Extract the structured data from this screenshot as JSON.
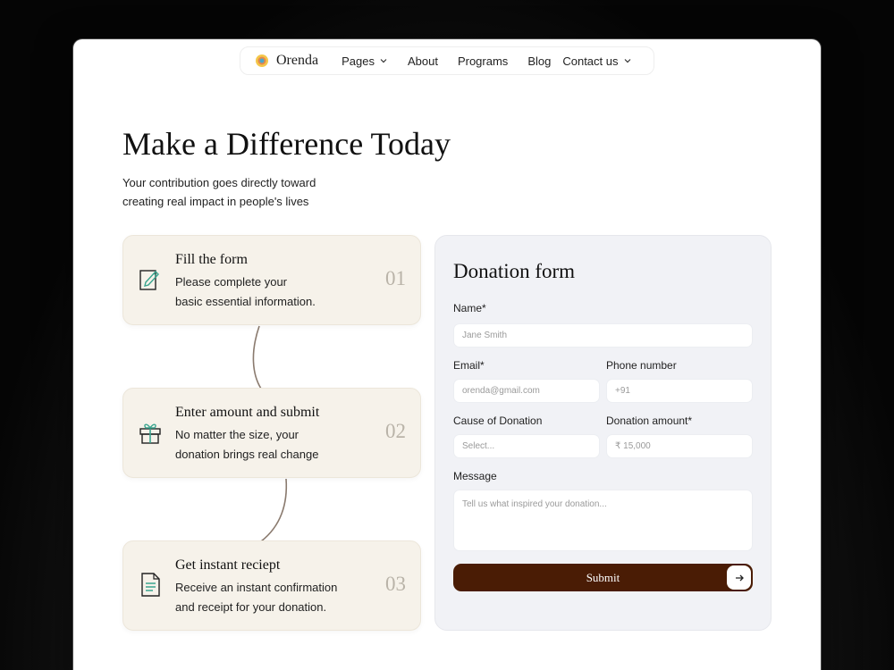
{
  "nav": {
    "brand": "Orenda",
    "items": [
      {
        "label": "Pages",
        "dropdown": true
      },
      {
        "label": "About",
        "dropdown": false
      },
      {
        "label": "Programs",
        "dropdown": false
      },
      {
        "label": "Blog",
        "dropdown": false
      },
      {
        "label": "Contact us",
        "dropdown": true
      }
    ]
  },
  "hero": {
    "title": "Make a Difference Today",
    "subtitle_line1": "Your contribution goes directly toward",
    "subtitle_line2": "creating real impact in people's lives"
  },
  "steps": [
    {
      "title": "Fill the form",
      "desc_line1": "Please complete your",
      "desc_line2": "basic essential information.",
      "number": "01",
      "icon": "form-pen-icon"
    },
    {
      "title": "Enter amount and submit",
      "desc_line1": "No matter the size, your",
      "desc_line2": "donation brings real change",
      "number": "02",
      "icon": "gift-icon"
    },
    {
      "title": "Get instant reciept",
      "desc_line1": "Receive an instant confirmation",
      "desc_line2": "and receipt for your donation.",
      "number": "03",
      "icon": "receipt-icon"
    }
  ],
  "form": {
    "title": "Donation form",
    "name_label": "Name*",
    "name_placeholder": "Jane Smith",
    "email_label": "Email*",
    "email_placeholder": "orenda@gmail.com",
    "phone_label": "Phone number",
    "phone_placeholder": "+91",
    "cause_label": "Cause of Donation",
    "cause_placeholder": "Select...",
    "amount_label": "Donation amount*",
    "amount_placeholder": "₹ 15,000",
    "message_label": "Message",
    "message_placeholder": "Tell us what inspired your donation...",
    "submit_label": "Submit"
  },
  "colors": {
    "accent": "#4a1c05",
    "step_bg": "#f6f2ea",
    "form_bg": "#f1f2f6",
    "icon_teal": "#3aa58f"
  }
}
